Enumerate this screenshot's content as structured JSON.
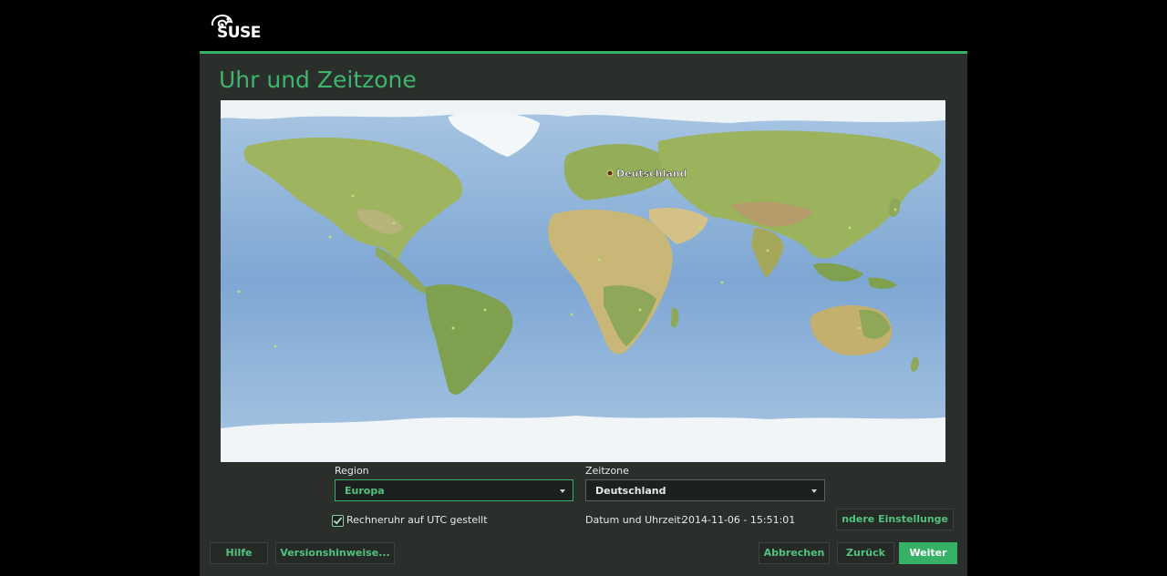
{
  "brand": {
    "logo_text": "SUSE"
  },
  "page": {
    "title": "Uhr und Zeitzone"
  },
  "map": {
    "selected_label": "Deutschland",
    "colors": {
      "ocean": "#7ea7d3",
      "land": "#9fb45e",
      "ice": "#f4f7f9",
      "desert": "#d8c58a",
      "marker": "#b8e07a"
    }
  },
  "form": {
    "region_label": "Region",
    "region_value": "Europa",
    "timezone_label": "Zeitzone",
    "timezone_value": "Deutschland",
    "utc_checkbox_label": "Rechneruhr auf UTC gestellt",
    "utc_checked": true,
    "datetime_label": "Datum und Uhrzeit:",
    "datetime_value": "2014-11-06 - 15:51:01",
    "other_settings_button": "ndere Einstellunge"
  },
  "footer": {
    "help": "Hilfe",
    "release_notes": "Versionshinweise...",
    "abort": "Abbrechen",
    "back": "Zurück",
    "next": "Weiter"
  }
}
